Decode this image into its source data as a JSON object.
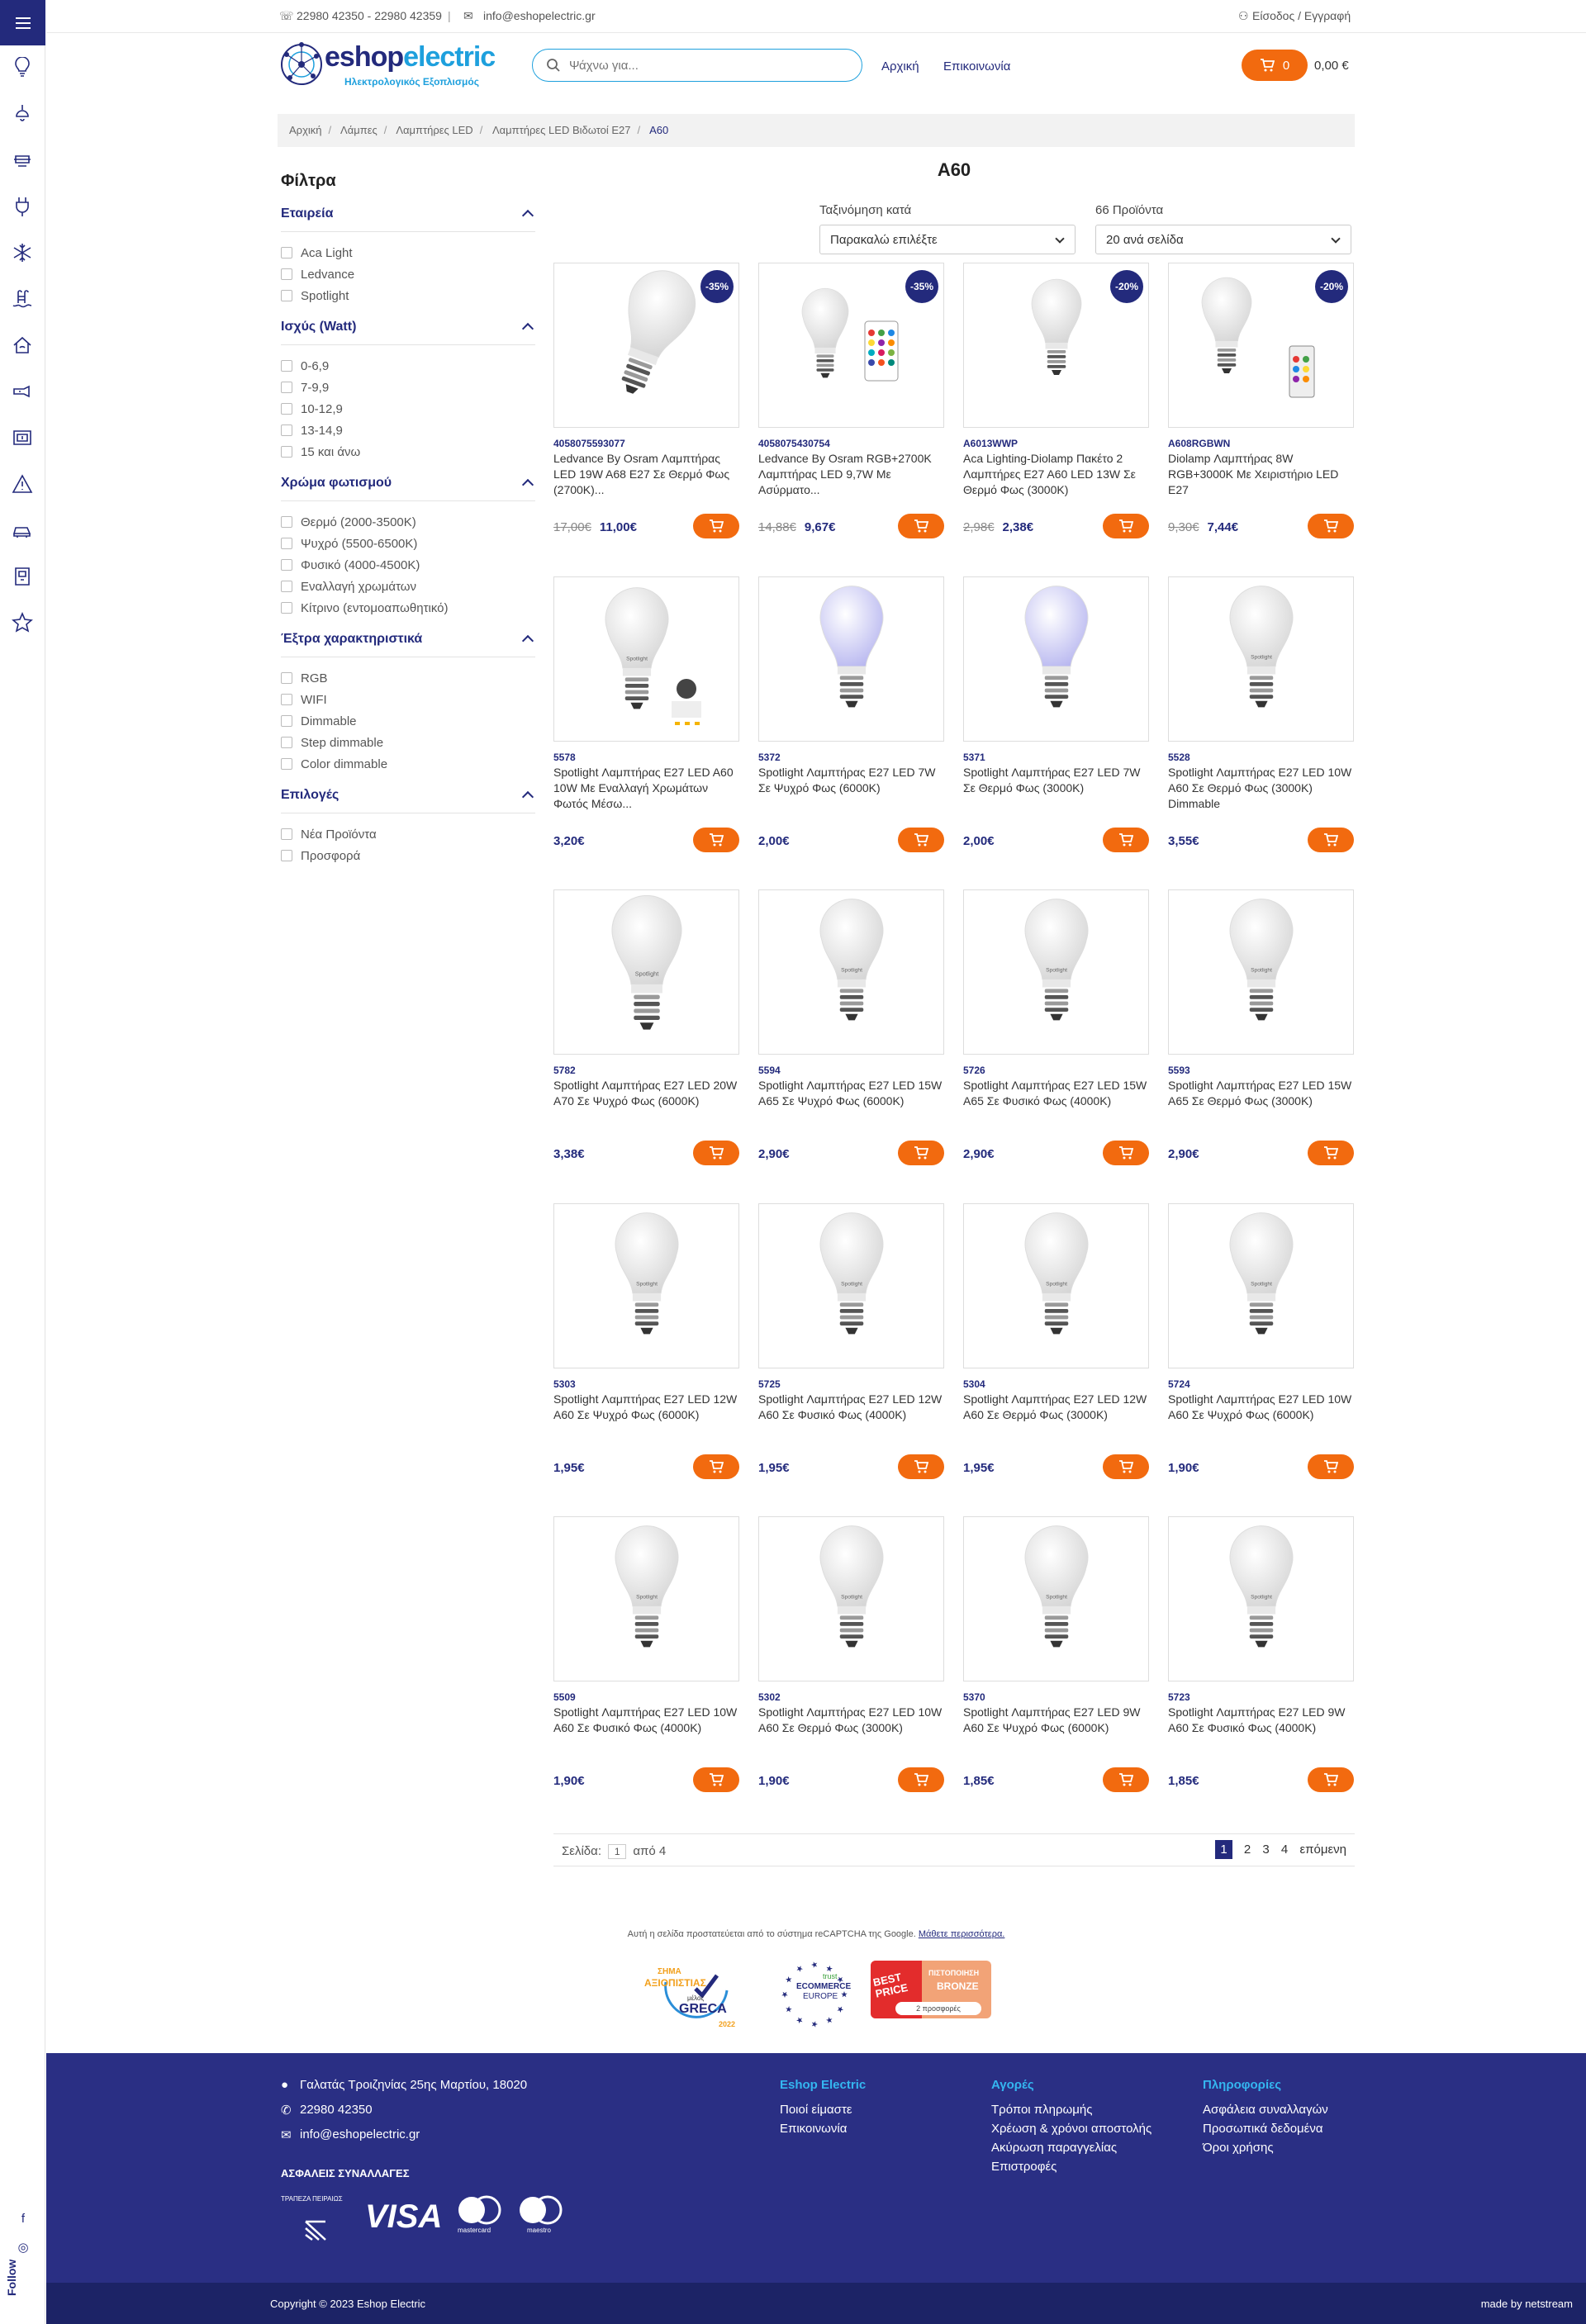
{
  "topbar": {
    "phone": "22980 42350 - 22980 42359",
    "email": "info@eshopelectric.gr",
    "login": "Είσοδος / Εγγραφή"
  },
  "header": {
    "logo_text": "eshopelectric",
    "logo_sub": "Ηλεκτρολογικός Εξοπλισμός",
    "search_placeholder": "Ψάχνω για...",
    "nav": [
      "Αρχική",
      "Επικοινωνία"
    ],
    "cart_count": "0",
    "cart_total": "0,00 €"
  },
  "breadcrumb": [
    "Αρχική",
    "Λάμπες",
    "Λαμπτήρες LED",
    "Λαμπτήρες LED Βιδωτοί E27",
    "A60"
  ],
  "filters": {
    "title": "Φίλτρα",
    "groups": [
      {
        "title": "Εταιρεία",
        "options": [
          "Aca Light",
          "Ledvance",
          "Spotlight"
        ]
      },
      {
        "title": "Ισχύς (Watt)",
        "options": [
          "0-6,9",
          "7-9,9",
          "10-12,9",
          "13-14,9",
          "15 και άνω"
        ]
      },
      {
        "title": "Χρώμα φωτισμού",
        "options": [
          "Θερμό (2000-3500K)",
          "Ψυχρό (5500-6500K)",
          "Φυσικό (4000-4500K)",
          "Εναλλαγή χρωμάτων",
          "Κίτρινο (εντομοαπωθητικό)"
        ]
      },
      {
        "title": "Έξτρα χαρακτηριστικά",
        "options": [
          "RGB",
          "WIFI",
          "Dimmable",
          "Step dimmable",
          "Color dimmable"
        ]
      },
      {
        "title": "Επιλογές",
        "options": [
          "Νέα Προϊόντα",
          "Προσφορά"
        ]
      }
    ]
  },
  "listing": {
    "title": "A60",
    "sort_label": "Ταξινόμηση κατά",
    "sort_value": "Παρακαλώ επιλέξτε",
    "count_label": "66 Προϊόντα",
    "per_page": "20 ανά σελίδα"
  },
  "products": [
    {
      "code": "4058075593077",
      "name": "Ledvance By Osram Λαμπτήρας LED 19W A68 E27 Σε Θερμό Φως (2700K)...",
      "old_price": "17,00€",
      "price": "11,00€",
      "badge": "-35%",
      "img": "osram-big"
    },
    {
      "code": "4058075430754",
      "name": "Ledvance By Osram RGB+2700K Λαμπτήρας LED 9,7W Με Ασύρματο...",
      "old_price": "14,88€",
      "price": "9,67€",
      "badge": "-35%",
      "img": "rgb-remote"
    },
    {
      "code": "A6013WWP",
      "name": "Aca Lighting-Diolamp Πακέτο 2 Λαμπτήρες E27 A60 LED 13W Σε Θερμό Φως (3000K)",
      "old_price": "2,98€",
      "price": "2,38€",
      "badge": "-20%",
      "img": "aca"
    },
    {
      "code": "A608RGBWN",
      "name": "Diolamp Λαμπτήρας 8W RGB+3000K Με Χειριστήριο LED E27",
      "old_price": "9,30€",
      "price": "7,44€",
      "badge": "-20%",
      "img": "diolamp-rgb"
    },
    {
      "code": "5578",
      "name": "Spotlight Λαμπτήρας E27 LED A60 10W Με Εναλλαγή Χρωμάτων Φωτός Μέσω...",
      "old_price": "",
      "price": "3,20€",
      "badge": "",
      "img": "spot-info"
    },
    {
      "code": "5372",
      "name": "Spotlight Λαμπτήρας E27 LED 7W Σε Ψυχρό Φως (6000K)",
      "old_price": "",
      "price": "2,00€",
      "badge": "",
      "img": "spot-lit"
    },
    {
      "code": "5371",
      "name": "Spotlight Λαμπτήρας E27 LED 7W Σε Θερμό Φως (3000K)",
      "old_price": "",
      "price": "2,00€",
      "badge": "",
      "img": "spot-lit"
    },
    {
      "code": "5528",
      "name": "Spotlight Λαμπτήρας E27 LED 10W A60 Σε Θερμό Φως (3000K) Dimmable",
      "old_price": "",
      "price": "3,55€",
      "badge": "",
      "img": "spot"
    },
    {
      "code": "5782",
      "name": "Spotlight Λαμπτήρας E27 LED 20W A70 Σε Ψυχρό Φως (6000K)",
      "old_price": "",
      "price": "3,38€",
      "badge": "",
      "img": "spot-big"
    },
    {
      "code": "5594",
      "name": "Spotlight Λαμπτήρας E27 LED 15W A65 Σε Ψυχρό Φως (6000K)",
      "old_price": "",
      "price": "2,90€",
      "badge": "",
      "img": "spot"
    },
    {
      "code": "5726",
      "name": "Spotlight Λαμπτήρας E27 LED 15W A65 Σε Φυσικό Φως (4000K)",
      "old_price": "",
      "price": "2,90€",
      "badge": "",
      "img": "spot"
    },
    {
      "code": "5593",
      "name": "Spotlight Λαμπτήρας E27 LED 15W A65 Σε Θερμό Φως (3000K)",
      "old_price": "",
      "price": "2,90€",
      "badge": "",
      "img": "spot"
    },
    {
      "code": "5303",
      "name": "Spotlight Λαμπτήρας E27 LED 12W A60 Σε Ψυχρό Φως (6000K)",
      "old_price": "",
      "price": "1,95€",
      "badge": "",
      "img": "spot"
    },
    {
      "code": "5725",
      "name": "Spotlight Λαμπτήρας E27 LED 12W A60 Σε Φυσικό Φως (4000K)",
      "old_price": "",
      "price": "1,95€",
      "badge": "",
      "img": "spot"
    },
    {
      "code": "5304",
      "name": "Spotlight Λαμπτήρας E27 LED 12W A60 Σε Θερμό Φως (3000K)",
      "old_price": "",
      "price": "1,95€",
      "badge": "",
      "img": "spot"
    },
    {
      "code": "5724",
      "name": "Spotlight Λαμπτήρας E27 LED 10W A60 Σε Ψυχρό Φως (6000K)",
      "old_price": "",
      "price": "1,90€",
      "badge": "",
      "img": "spot"
    },
    {
      "code": "5509",
      "name": "Spotlight Λαμπτήρας E27 LED 10W A60 Σε Φυσικό Φως (4000K)",
      "old_price": "",
      "price": "1,90€",
      "badge": "",
      "img": "spot"
    },
    {
      "code": "5302",
      "name": "Spotlight Λαμπτήρας E27 LED 10W A60 Σε Θερμό Φως (3000K)",
      "old_price": "",
      "price": "1,90€",
      "badge": "",
      "img": "spot"
    },
    {
      "code": "5370",
      "name": "Spotlight Λαμπτήρας E27 LED 9W A60 Σε Ψυχρό Φως (6000K)",
      "old_price": "",
      "price": "1,85€",
      "badge": "",
      "img": "spot"
    },
    {
      "code": "5723",
      "name": "Spotlight Λαμπτήρας E27 LED 9W A60 Σε Φυσικό Φως (4000K)",
      "old_price": "",
      "price": "1,85€",
      "badge": "",
      "img": "spot"
    }
  ],
  "pagination": {
    "label": "Σελίδα:",
    "current": "1",
    "of": "από 4",
    "pages": [
      "1",
      "2",
      "3",
      "4"
    ],
    "next": "επόμενη"
  },
  "recaptcha": {
    "text": "Αυτή η σελίδα προστατεύεται από το σύστημα reCAPTCHA της Google.",
    "link": "Μάθετε περισσότερα."
  },
  "badges": {
    "greca": {
      "line1": "ΣΗΜΑ",
      "line2": "ΑΞΙΟΠΙΣΤΙΑΣ",
      "line3": "μέλος",
      "brand": "GRECA",
      "year": "2022"
    },
    "ecommerce": {
      "line1": "trust",
      "line2": "ECOMMERCE",
      "line3": "EUROPE"
    },
    "bestprice": {
      "brand": "BEST PRICE",
      "tag": "ΠΙΣΤΟΠΟΙΗΣΗ",
      "level": "BRONZE",
      "offers": "2 προσφορές"
    }
  },
  "footer": {
    "address": "Γαλατάς Τροιζηνίας 25ης Μαρτίου, 18020",
    "phone": "22980 42350",
    "email": "info@eshopelectric.gr",
    "secure_title": "ΑΣΦΑΛΕΙΣ ΣΥΝΑΛΛΑΓΕΣ",
    "bank": "ΤΡΑΠΕΖΑ ΠΕΙΡΑΙΩΣ",
    "cards": [
      "VISA",
      "mastercard",
      "maestro"
    ],
    "columns": [
      {
        "title": "Eshop Electric",
        "links": [
          "Ποιοί είμαστε",
          "Επικοινωνία"
        ]
      },
      {
        "title": "Αγορές",
        "links": [
          "Τρόποι πληρωμής",
          "Χρέωση & χρόνοι αποστολής",
          "Ακύρωση παραγγελίας",
          "Επιστροφές"
        ]
      },
      {
        "title": "Πληροφορίες",
        "links": [
          "Ασφάλεια συναλλαγών",
          "Προσωπικά δεδομένα",
          "Όροι χρήσης"
        ]
      }
    ],
    "copyright": "Copyright © 2023 Eshop Electric",
    "madeby": "made by netstream"
  },
  "sidebar": {
    "follow": "Follow",
    "icons": [
      "bulb-icon",
      "ceiling-lamp-icon",
      "led-strip-icon",
      "plug-icon",
      "snowflake-icon",
      "pool-icon",
      "home-automation-icon",
      "flashlight-icon",
      "panel-icon",
      "warning-icon",
      "car-icon",
      "intercom-icon",
      "star-icon"
    ]
  },
  "colors": {
    "primary": "#232a7c",
    "accent": "#f26a0f",
    "link": "#1ea0dd",
    "footer": "#2a2f84"
  }
}
